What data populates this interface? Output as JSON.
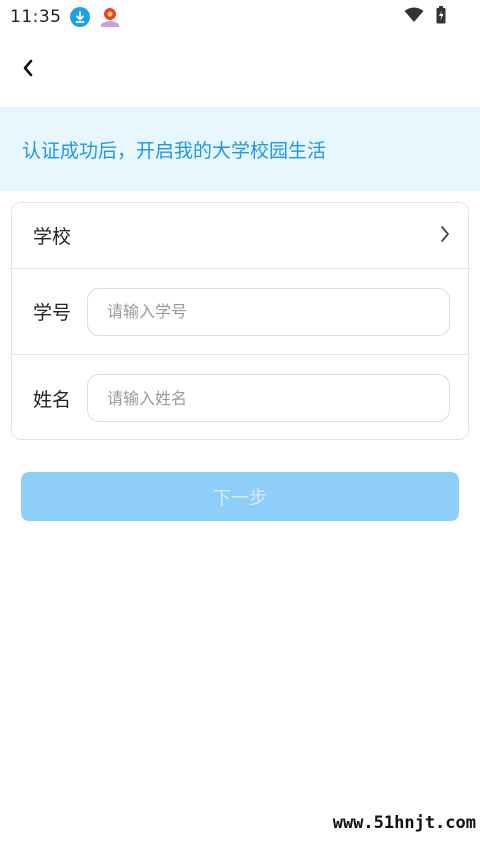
{
  "status_bar": {
    "time": "11:35",
    "icons": [
      "download-icon",
      "app-notification-icon",
      "wifi-icon",
      "battery-icon"
    ]
  },
  "nav": {
    "back_icon": "chevron-left-icon"
  },
  "banner": {
    "text": "认证成功后，开启我的大学校园生活"
  },
  "form": {
    "school_label": "学校",
    "student_id": {
      "label": "学号",
      "placeholder": "请输入学号",
      "value": ""
    },
    "name": {
      "label": "姓名",
      "placeholder": "请输入姓名",
      "value": ""
    }
  },
  "next_button": {
    "label": "下一步"
  },
  "watermark": "www.51hnjt.com",
  "colors": {
    "accent": "#1f98e3",
    "banner_bg": "#e8f6fd",
    "button_disabled_bg": "#8fcef9",
    "button_disabled_text": "#d4ecfc"
  }
}
